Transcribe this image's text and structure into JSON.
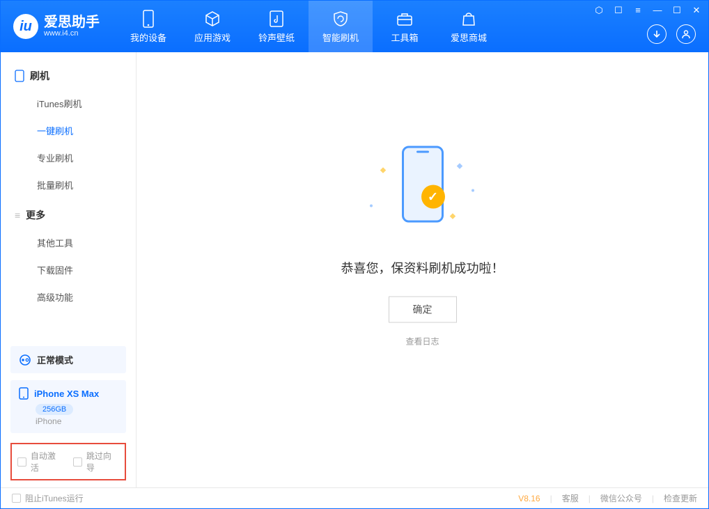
{
  "app": {
    "title": "爱思助手",
    "subtitle": "www.i4.cn"
  },
  "tabs": [
    {
      "label": "我的设备"
    },
    {
      "label": "应用游戏"
    },
    {
      "label": "铃声壁纸"
    },
    {
      "label": "智能刷机"
    },
    {
      "label": "工具箱"
    },
    {
      "label": "爱思商城"
    }
  ],
  "sidebar": {
    "group1": {
      "title": "刷机",
      "items": [
        {
          "label": "iTunes刷机"
        },
        {
          "label": "一键刷机"
        },
        {
          "label": "专业刷机"
        },
        {
          "label": "批量刷机"
        }
      ]
    },
    "group2": {
      "title": "更多",
      "items": [
        {
          "label": "其他工具"
        },
        {
          "label": "下载固件"
        },
        {
          "label": "高级功能"
        }
      ]
    },
    "mode": "正常模式",
    "device": {
      "name": "iPhone XS Max",
      "storage": "256GB",
      "type": "iPhone"
    },
    "checkboxes": {
      "auto_activate": "自动激活",
      "skip_guide": "跳过向导"
    }
  },
  "main": {
    "message": "恭喜您，保资料刷机成功啦！",
    "ok_button": "确定",
    "view_log": "查看日志"
  },
  "status": {
    "block_itunes": "阻止iTunes运行",
    "version": "V8.16",
    "customer_service": "客服",
    "wechat": "微信公众号",
    "check_update": "检查更新"
  }
}
